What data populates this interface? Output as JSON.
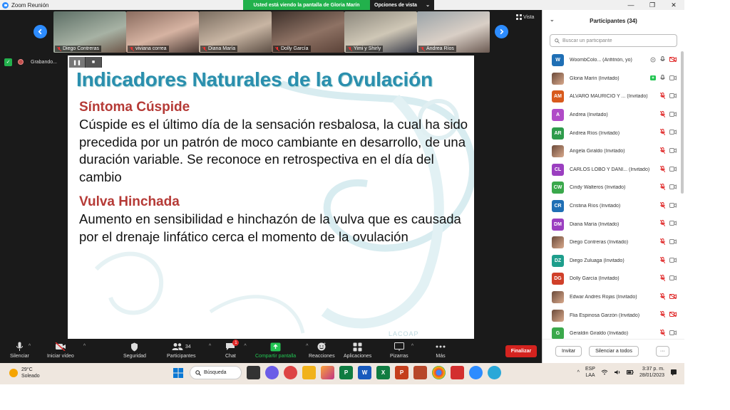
{
  "window": {
    "title": "Zoom Reunión",
    "minimize": "—",
    "maximize": "❐",
    "close": "✕"
  },
  "share_banner": {
    "message": "Usted está viendo la pantalla de Gloria Marín",
    "options_label": "Opciones de vista",
    "options_caret": "⌄"
  },
  "thumbnails": [
    {
      "name": "Diego Contreras",
      "bg": "#7f8f86"
    },
    {
      "name": "viviana correa",
      "bg": "#b58a7a"
    },
    {
      "name": "Diana María",
      "bg": "#9c8b7d"
    },
    {
      "name": "Dolly García",
      "bg": "#6c5a4f"
    },
    {
      "name": "Yimi y Shirly",
      "bg": "#a99f8e"
    },
    {
      "name": "Andrea Ríos",
      "bg": "#b3aaa0"
    }
  ],
  "view_label": "Vista",
  "view_icon": "grid-icon",
  "recording": {
    "label": "Grabando..."
  },
  "slide": {
    "title": "Indicadores Naturales de la Ovulación",
    "sections": [
      {
        "heading": "Síntoma Cúspide",
        "text": "Cúspide es el último día de la sensación resbalosa, la cual ha sido precedida por un patrón de moco cambiante  en desarrollo, de una duración variable. Se reconoce en retrospectiva en el día del cambio"
      },
      {
        "heading": "Vulva Hinchada",
        "text": "Aumento en sensibilidad e hinchazón de la vulva que es causada por el drenaje linfático cerca el momento de la ovulación"
      }
    ],
    "footer_mark": "LACOAP",
    "title_color": "#2a8fae",
    "heading_color": "#b53a36"
  },
  "participants": {
    "title": "Participantes (34)",
    "search_placeholder": "Buscar un participante",
    "list": [
      {
        "initials": "W",
        "color": "#1f6fb5",
        "name": "WoombColo...     (Anfitrión, yo)",
        "cam_off": true
      },
      {
        "initials": "",
        "color": "photo",
        "name": "Gloria Marín (Invitado)",
        "sharing": true
      },
      {
        "initials": "AM",
        "color": "#d85a1c",
        "name": "ALVARO MAURICIO Y ...  (Invitado)"
      },
      {
        "initials": "A",
        "color": "#b04bc7",
        "name": "Andrea (Invitado)"
      },
      {
        "initials": "AR",
        "color": "#2e9b4b",
        "name": "Andrea Ríos (Invitado)"
      },
      {
        "initials": "",
        "color": "photo",
        "name": "Angela Giraldo (Invitado)"
      },
      {
        "initials": "CL",
        "color": "#9b3fc0",
        "name": "CARLOS LOBO Y DANI...  (Invitado)"
      },
      {
        "initials": "CW",
        "color": "#3aa84b",
        "name": "Cindy Walteros (Invitado)"
      },
      {
        "initials": "CR",
        "color": "#1f6fb5",
        "name": "Cristina Ríos (Invitado)"
      },
      {
        "initials": "DM",
        "color": "#9b3fc0",
        "name": "Diana María (Invitado)"
      },
      {
        "initials": "",
        "color": "photo",
        "name": "Diego Contreras (Invitado)"
      },
      {
        "initials": "DZ",
        "color": "#1e9e8c",
        "name": "Diego Zuluaga (Invitado)"
      },
      {
        "initials": "DG",
        "color": "#d0402a",
        "name": "Dolly García (Invitado)"
      },
      {
        "initials": "",
        "color": "photo",
        "name": "Edwar Andrés  Rojas (Invitado)",
        "cam_off": true
      },
      {
        "initials": "",
        "color": "photo",
        "name": "Flia Espinosa Garzón (Invitado)",
        "cam_off": true
      },
      {
        "initials": "G",
        "color": "#3aa84b",
        "name": "Geraldin Giraldo (Invitado)"
      }
    ],
    "invite_label": "Invitar",
    "mute_all_label": "Silenciar a todos",
    "more_label": "···"
  },
  "toolbar": {
    "mute": "Silenciar",
    "video": "Iniciar vídeo",
    "security": "Seguridad",
    "participants": "Participantes",
    "participants_count": "34",
    "chat": "Chat",
    "chat_badge": "1",
    "share": "Compartir pantalla",
    "reactions": "Reacciones",
    "apps": "Aplicaciones",
    "whiteboards": "Pizarras",
    "more": "Más",
    "end": "Finalizar"
  },
  "taskbar": {
    "temp": "29°C",
    "weather": "Soleado",
    "search": "Búsqueda",
    "lang": "ESP",
    "region": "LAA",
    "time": "3:37 p. m.",
    "date": "28/01/2023"
  }
}
